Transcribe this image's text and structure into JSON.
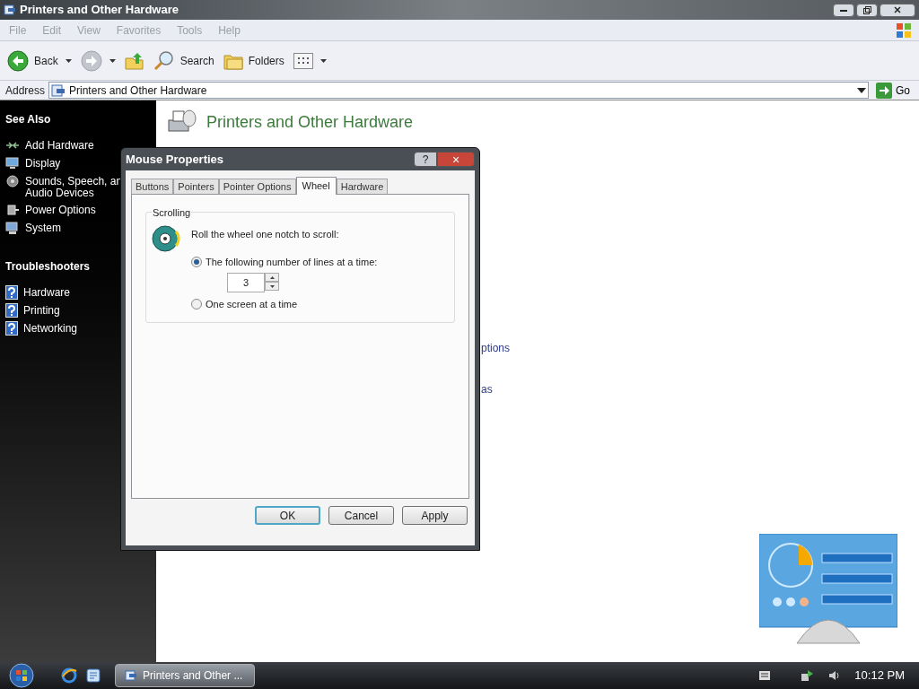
{
  "window": {
    "title": "Printers and Other Hardware"
  },
  "menu": [
    "File",
    "Edit",
    "View",
    "Favorites",
    "Tools",
    "Help"
  ],
  "toolbar": [
    {
      "kind": "back",
      "label": "Back",
      "disabled": false
    },
    {
      "kind": "forward",
      "disabled": true
    },
    {
      "kind": "up"
    },
    {
      "kind": "search",
      "label": "Search"
    },
    {
      "kind": "folders",
      "label": "Folders"
    },
    {
      "kind": "views"
    }
  ],
  "address": {
    "label": "Address",
    "value": "Printers and Other Hardware",
    "go": "Go"
  },
  "sidebar": [
    {
      "title": "See Also",
      "items": [
        {
          "kind": "add",
          "label": "Add Hardware"
        },
        {
          "kind": "display",
          "label": "Display"
        },
        {
          "kind": "sound",
          "label": "Sounds, Speech, an\nAudio Devices"
        },
        {
          "kind": "power",
          "label": "Power Options"
        },
        {
          "kind": "system",
          "label": "System"
        }
      ]
    },
    {
      "title": "Troubleshooters",
      "items": [
        {
          "kind": "help",
          "label": "Hardware"
        },
        {
          "kind": "help",
          "label": "Printing"
        },
        {
          "kind": "help",
          "label": "Networking"
        }
      ]
    }
  ],
  "content": {
    "heading": "Printers and Other Hardware",
    "links": [
      "ptions",
      "as"
    ]
  },
  "dialog": {
    "title": "Mouse Properties",
    "help": "?",
    "close": "×",
    "tabs": [
      {
        "label": "Buttons",
        "selected": false
      },
      {
        "label": "Pointers",
        "selected": false
      },
      {
        "label": "Pointer Options",
        "selected": false
      },
      {
        "label": "Wheel",
        "selected": true
      },
      {
        "label": "Hardware",
        "selected": false
      }
    ],
    "group": "Scrolling",
    "prompt": "Roll the wheel one notch to scroll:",
    "options": [
      {
        "label": "The following number of lines at a time:",
        "selected": true
      },
      {
        "label": "One screen at a time",
        "selected": false
      }
    ],
    "lines": "3",
    "buttons": [
      {
        "label": "OK",
        "default": true
      },
      {
        "label": "Cancel",
        "default": false
      },
      {
        "label": "Apply",
        "default": false
      }
    ]
  },
  "taskbar": {
    "task": "Printers and Other ...",
    "clock": "10:12 PM"
  }
}
